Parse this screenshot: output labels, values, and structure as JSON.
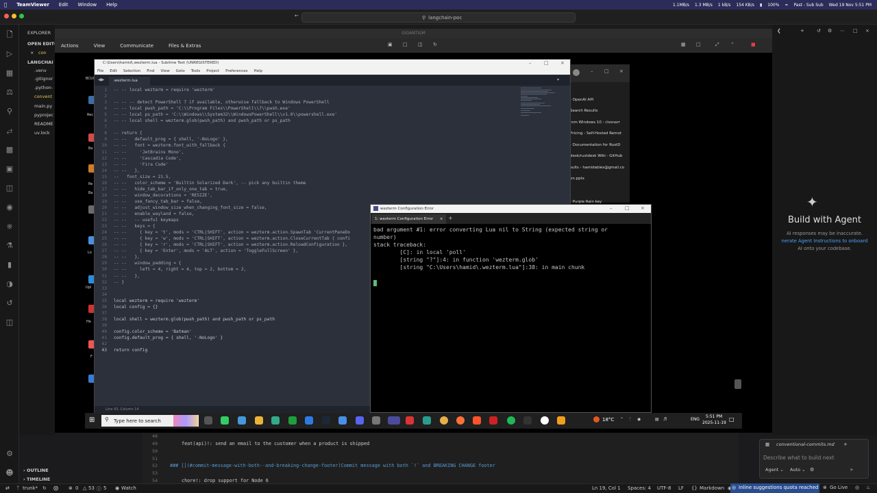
{
  "mac_menubar": {
    "items": [
      "TeamViewer",
      "Edit",
      "Window",
      "Help"
    ],
    "net_up": "1.1MB/s",
    "net_down": "1.3 MB/s",
    "net2_up": "1 kB/s",
    "net2_down": "154 KB/s",
    "battery": "100%",
    "now_playing": "Past - Sub Sub",
    "datetime": "Wed 19 Nov 5:51 PM"
  },
  "vscode": {
    "search": "langchain-poc",
    "explorer_title": "EXPLORER",
    "open_editors": "OPEN EDITO",
    "open_file": "con",
    "project": "LANGCHAI",
    "files": [
      ".venv",
      ".gitignor",
      ".python-",
      "convent",
      "main.py",
      "pyprojec",
      "README",
      "uv.lock"
    ],
    "outline": "OUTLINE",
    "timeline": "TIMELINE",
    "bottom_lines": [
      {
        "n": "48",
        "t": ""
      },
      {
        "n": "49",
        "t": "feat(api)!: send an email to the customer when a product is shipped"
      },
      {
        "n": "50",
        "t": ""
      },
      {
        "n": "51",
        "t": ""
      },
      {
        "n": "52",
        "t": "### [](#commit-message-with-both--and-breaking-change-footer)Commit message with both `!` and BREAKING CHANGE footer"
      },
      {
        "n": "53",
        "t": ""
      },
      {
        "n": "54",
        "t": "chore!: drop support for Node 6"
      }
    ],
    "status": {
      "branch": "trunk*",
      "errors": "0",
      "warnings": "53",
      "info": "5",
      "watch": "Watch",
      "position": "Ln 19, Col 1",
      "spaces": "Spaces: 4",
      "encoding": "UTF-8",
      "eol": "LF",
      "language": "Markdown",
      "quota": "Inline suggestions quota reached",
      "golive": "Go Live"
    },
    "agent": {
      "title": "Build with Agent",
      "line1": "AI responses may be inaccurate.",
      "line2": "nerate Agent Instructions to onboard",
      "line3": "AI onto your codebase.",
      "chat_file": "conventional-commits.md",
      "chat_placeholder": "Describe what to build next",
      "mode": "Agent",
      "model": "Auto"
    }
  },
  "teamviewer": {
    "title": "GIGANTIUM",
    "toolbar": [
      "Actions",
      "View",
      "Communicate",
      "Files & Extras"
    ]
  },
  "sublime": {
    "title": "C:\\Users\\hamid\\.wezterm.lua - Sublime Text (UNREGISTERED)",
    "menu": [
      "File",
      "Edit",
      "Selection",
      "Find",
      "View",
      "Goto",
      "Tools",
      "Project",
      "Preferences",
      "Help"
    ],
    "tab": ".wezterm.lua",
    "status": "Line 43, Column 14",
    "lines": [
      "-- -- local wezterm = require 'wezterm'",
      "",
      "-- -- -- detect PowerShell 7 if available, otherwise fallback to Windows PowerShell",
      "-- -- local pwsh_path = 'C:\\\\Program Files\\\\PowerShell\\\\7\\\\pwsh.exe'",
      "-- -- local ps_path = 'C:\\\\Windows\\\\System32\\\\WindowsPowerShell\\\\v1.0\\\\powershell.exe'",
      "-- -- local shell = wezterm.glob(pwsh_path) and pwsh_path or ps_path",
      "",
      "-- return {",
      "-- --   default_prog = { shell, '-NoLogo' },",
      "-- --   font = wezterm.font_with_fallback {",
      "-- --     'JetBrains Mono',",
      "-- --     'Cascadia Code',",
      "-- --     'Fira Code'",
      "-- --   },",
      "--   font_size = 21.5,",
      "-- --   color_scheme = 'Builtin Solarized Dark', -- pick any builtin theme",
      "-- --   hide_tab_bar_if_only_one_tab = true,",
      "-- --   window_decorations = 'RESIZE',",
      "-- --   use_fancy_tab_bar = false,",
      "-- --   adjust_window_size_when_changing_font_size = false,",
      "-- --   enable_wayland = false,",
      "-- --   -- useful keymaps",
      "-- --   keys = {",
      "-- --     { key = 't', mods = 'CTRL|SHIFT', action = wezterm.action.SpawnTab 'CurrentPaneDo",
      "-- --     { key = 'w', mods = 'CTRL|SHIFT', action = wezterm.action.CloseCurrentTab { confi",
      "-- --     { key = 'r', mods = 'CTRL|SHIFT', action = wezterm.action.ReloadConfiguration },",
      "-- --     { key = 'Enter', mods = 'ALT', action = 'ToggleFullScreen' },",
      "-- --   },",
      "-- --   window_padding = {",
      "-- --     left = 4, right = 4, top = 2, bottom = 2,",
      "-- --   },",
      "-- }",
      "",
      "",
      "local wezterm = require 'wezterm'",
      "local config = {}",
      "",
      "local shell = wezterm.glob(pwsh_path) and pwsh_path or ps_path",
      "",
      "config.color_scheme = 'Batman'",
      "config.default_prog = { shell, '-NoLogo' }",
      "",
      "return config"
    ]
  },
  "wezterm": {
    "title": "wezterm Configuration Error",
    "tab": "1: wezterm Configuration Error",
    "output": "bad argument #1: error converting Lua nil to String (expected string or\nnumber)\nstack traceback:\n        [C]: in local 'poll'\n        [string \"?\"]:4: in function 'wezterm.glob'\n        [string \"C:\\Users\\hamid\\.wezterm.lua\"]:38: in main chunk"
  },
  "chrome_list": {
    "items": [
      "- OpenAI API",
      "Search Results",
      "rom Windows 10 : r/sonarr",
      "Pricing - Self-Hosted Remot",
      "- Documentation for RustD",
      "desk/rustdesk Wiki - GitHub",
      "sults - hamidables@gmail.co",
      "on.pptx",
      "",
      "",
      "- Purple Rain key"
    ]
  },
  "windows_taskbar": {
    "search_placeholder": "Type here to search",
    "temperature": "18°C",
    "lang": "ENG",
    "time": "5:51 PM",
    "date": "2025-11-19"
  },
  "desktop_icons": [
    "BCUI",
    "Rec",
    "Ba",
    "Re",
    "Ba",
    "Lo",
    "Upl",
    "He",
    "F"
  ]
}
